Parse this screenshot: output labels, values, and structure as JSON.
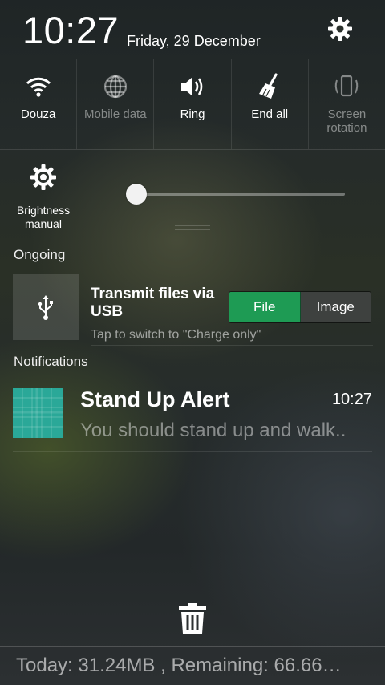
{
  "header": {
    "time": "10:27",
    "date": "Friday, 29 December"
  },
  "quick_settings": [
    {
      "label": "Douza",
      "icon": "wifi-icon",
      "active": true
    },
    {
      "label": "Mobile data",
      "icon": "globe-icon",
      "active": false
    },
    {
      "label": "Ring",
      "icon": "speaker-icon",
      "active": true
    },
    {
      "label": "End all",
      "icon": "broom-icon",
      "active": true
    },
    {
      "label": "Screen rotation",
      "icon": "rotation-icon",
      "active": false
    }
  ],
  "brightness": {
    "label": "Brightness manual",
    "level": 0.0
  },
  "sections": {
    "ongoing": "Ongoing",
    "notifications": "Notifications"
  },
  "usb": {
    "title": "Transmit files via USB",
    "subtitle": "Tap to switch to \"Charge only\"",
    "options": [
      "File",
      "Image"
    ],
    "selected": "File"
  },
  "notification": {
    "title": "Stand Up Alert",
    "time": "10:27",
    "text": "You should stand up and walk.."
  },
  "footer": {
    "data_usage": "Today:  31.24MB , Remaining:  66.66…"
  },
  "colors": {
    "accent_green": "#1e9b54",
    "notification_thumb": "#2aa898"
  }
}
